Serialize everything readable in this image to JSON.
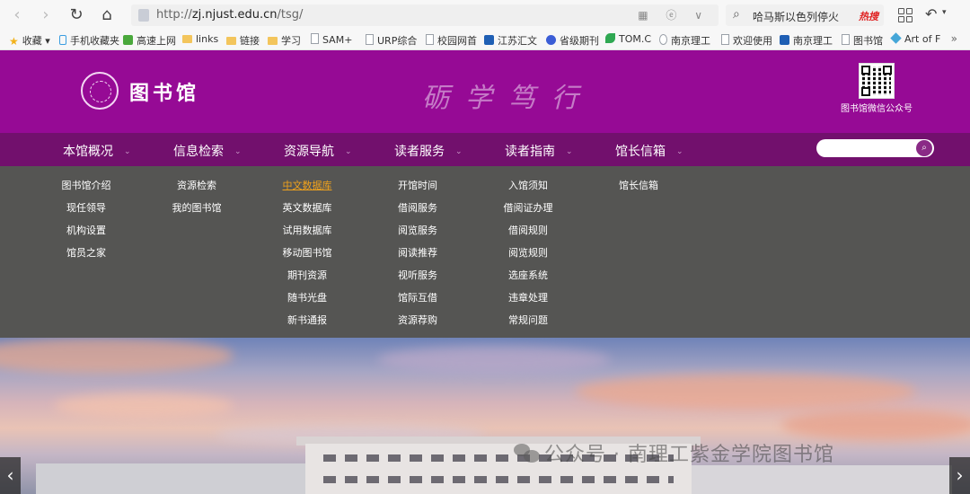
{
  "browser": {
    "back_glyph": "‹",
    "forward_glyph": "›",
    "reload_glyph": "↻",
    "home_glyph": "⌂",
    "url_prefix": "http://",
    "url_domain": "zj.njust.edu.cn",
    "url_path": "/tsg/",
    "url_icons": "▦ ⓔ ∨",
    "search_glyph": "⌕",
    "search_value": "哈马斯以色列停火",
    "hot_label": "热搜",
    "undo_glyph": "↶",
    "caret_glyph": "▾"
  },
  "bookmarks": [
    {
      "label": "收藏",
      "icon": "star-icon",
      "extra": "▾"
    },
    {
      "label": "手机收藏夹",
      "icon": "phone-icon"
    },
    {
      "label": "高速上网",
      "icon": "speed-icon"
    },
    {
      "label": "links",
      "icon": "folder-icon"
    },
    {
      "label": "链接",
      "icon": "folder-icon"
    },
    {
      "label": "学习",
      "icon": "folder-icon"
    },
    {
      "label": "SAM+",
      "icon": "page-icon"
    },
    {
      "label": "URP综合",
      "icon": "page-icon"
    },
    {
      "label": "校园网首",
      "icon": "page-icon"
    },
    {
      "label": "江苏汇文",
      "icon": "site-icon"
    },
    {
      "label": "省级期刊",
      "icon": "paw-icon"
    },
    {
      "label": "TOM.C",
      "icon": "leaf-icon"
    },
    {
      "label": "南京理工",
      "icon": "emblem-icon"
    },
    {
      "label": "欢迎使用",
      "icon": "page-icon"
    },
    {
      "label": "南京理工",
      "icon": "site-icon"
    },
    {
      "label": "图书馆",
      "icon": "page-icon"
    },
    {
      "label": "Art of F",
      "icon": "cube-icon"
    }
  ],
  "bookmarks_more": "»",
  "header": {
    "logo_text": "图书馆",
    "motto": "砺学笃行",
    "qr_caption": "图书馆微信公众号"
  },
  "nav": [
    {
      "label": "本馆概况",
      "chev": "⌄"
    },
    {
      "label": "信息检索",
      "chev": "⌄"
    },
    {
      "label": "资源导航",
      "chev": "⌄"
    },
    {
      "label": "读者服务",
      "chev": "⌄"
    },
    {
      "label": "读者指南",
      "chev": "⌄"
    },
    {
      "label": "馆长信箱",
      "chev": "⌄"
    }
  ],
  "site_search": {
    "placeholder": "",
    "button_glyph": "⌕"
  },
  "mega_menu": [
    [
      "图书馆介绍",
      "现任领导",
      "机构设置",
      "馆员之家"
    ],
    [
      "资源检索",
      "我的图书馆"
    ],
    [
      "中文数据库",
      "英文数据库",
      "试用数据库",
      "移动图书馆",
      "期刊资源",
      "随书光盘",
      "新书通报"
    ],
    [
      "开馆时间",
      "借阅服务",
      "阅览服务",
      "阅读推荐",
      "视听服务",
      "馆际互借",
      "资源荐购"
    ],
    [
      "入馆须知",
      "借阅证办理",
      "借阅规则",
      "阅览规则",
      "选座系统",
      "违章处理",
      "常规问题"
    ],
    [
      "馆长信箱"
    ]
  ],
  "highlighted_item": "中文数据库",
  "banner": {
    "watermark": "公众号 · 南理工紫金学院图书馆",
    "prev_glyph": "‹",
    "next_glyph": "›"
  },
  "colors": {
    "header_bg": "#960a95",
    "nav_bg": "#72106d",
    "menu_bg": "#555553",
    "highlight": "#f0a21c"
  }
}
